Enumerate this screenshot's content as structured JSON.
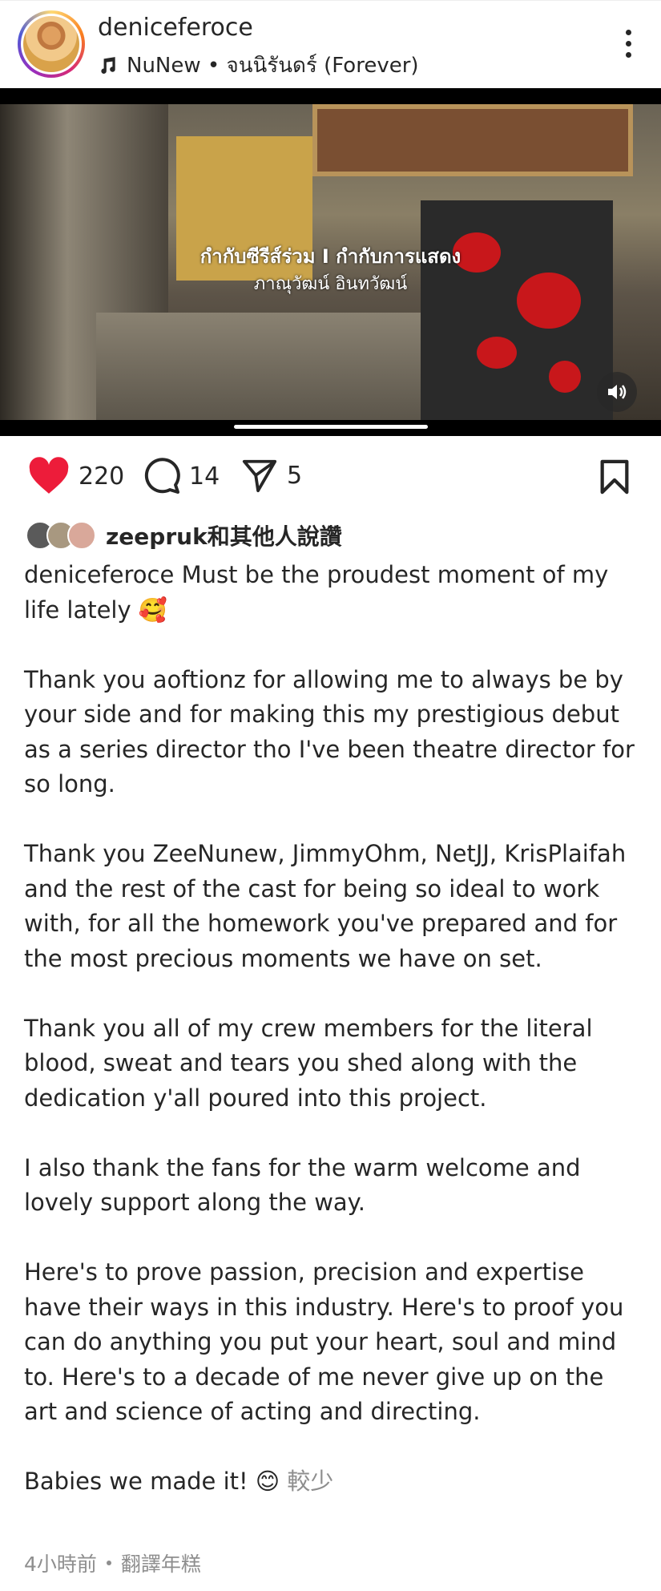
{
  "header": {
    "username": "deniceferoce",
    "music": "NuNew • จนนิรันดร์ (Forever)"
  },
  "media": {
    "subtitle_line1": "กำกับซีรีส์ร่วม I กำกับการแสดง",
    "subtitle_line2": "ภาณุวัฒน์ อินทวัฒน์"
  },
  "actions": {
    "likes": "220",
    "comments": "14",
    "shares": "5"
  },
  "liked_by": {
    "user": "zeepruk",
    "suffix": "和其他人說讚"
  },
  "caption": {
    "username": "deniceferoce",
    "line1": "Must be the proudest moment of my life lately 🥰",
    "p2": "Thank you aoftionz for allowing me to always be by your side and for making this my prestigious debut as a series director tho I've been theatre director for so long.",
    "p3": "Thank you ZeeNunew, JimmyOhm, NetJJ, KrisPlaifah and the rest of the cast for being so ideal to work with, for all the homework you've prepared and for the most precious moments we have on set.",
    "p4": "Thank you all of my crew members for the literal blood, sweat and tears you shed along with the dedication y'all poured into this project.",
    "p5": "I also thank the fans for the warm welcome and lovely support along the way.",
    "p6": "Here's to prove passion, precision and expertise have their ways in this industry. Here's to proof you can do anything you put your heart, soul and mind to.  Here's to a decade of me never give up on the art and science of acting and directing.",
    "p7": "Babies we made it! 😊",
    "less": "較少"
  },
  "footer": {
    "time": "4小時前",
    "translate": "翻譯年糕"
  },
  "colors": {
    "heart": "#ed1c3a",
    "text": "#262626",
    "muted": "#8e8e8e"
  }
}
